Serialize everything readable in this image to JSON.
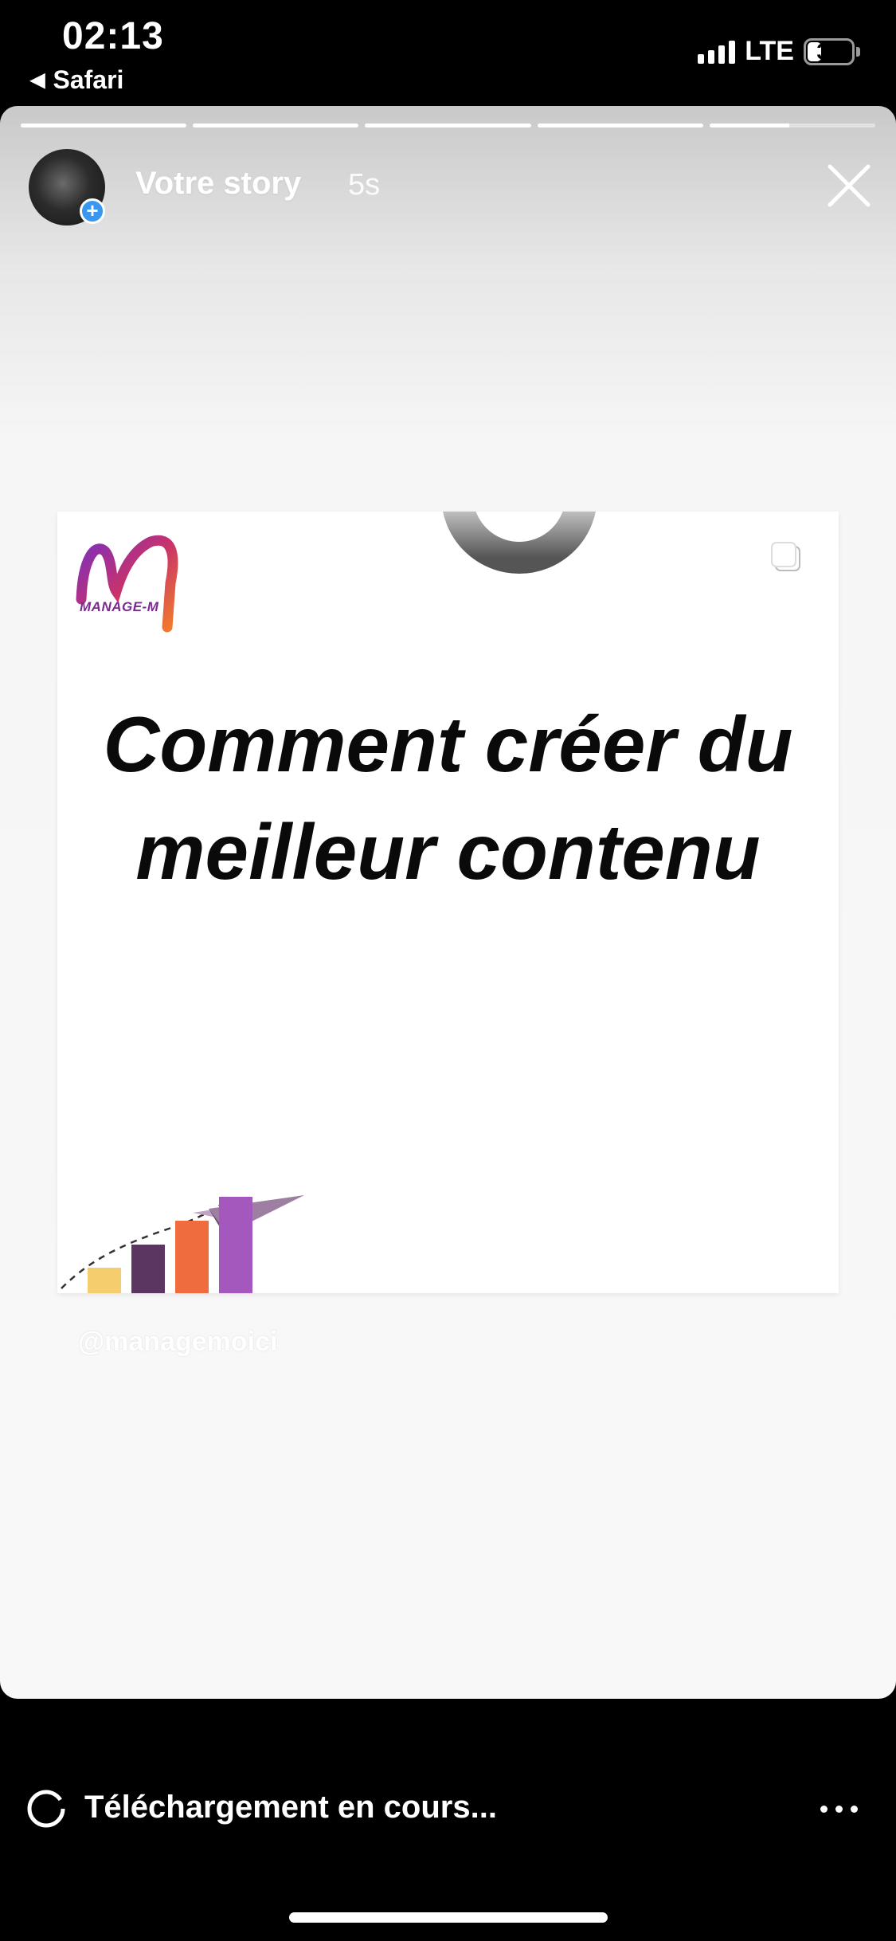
{
  "status_bar": {
    "time": "02:13",
    "back_app": "Safari",
    "network": "LTE",
    "battery": "30"
  },
  "story": {
    "progress": [
      1,
      1,
      1,
      1,
      0.48
    ],
    "username": "Votre story",
    "elapsed": "5s",
    "close_icon": "close-icon"
  },
  "post": {
    "logo_text": "MANAGE-M",
    "headline": "Comment créer du meilleur contenu",
    "chart_colors": [
      "#f5cd6c",
      "#5a3660",
      "#ef6c3f",
      "#a458bd"
    ]
  },
  "handle": "@managemoici",
  "bottom": {
    "download_label": "Téléchargement en cours...",
    "more_icon": "more-icon"
  },
  "colors": {
    "accent_plus": "#3897f0"
  }
}
